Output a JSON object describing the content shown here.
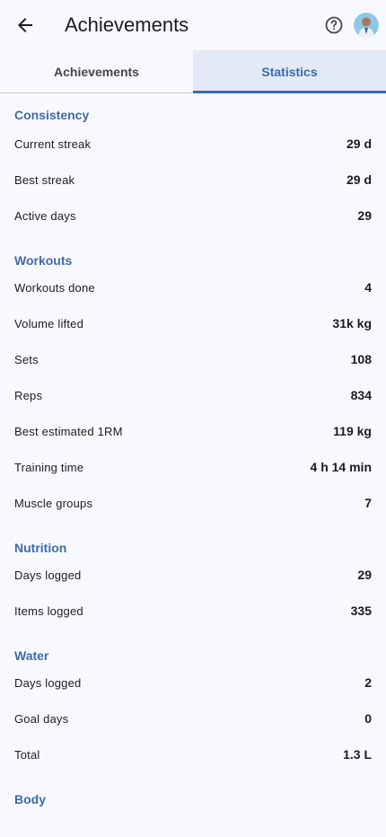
{
  "app_bar": {
    "title": "Achievements",
    "back_icon": "arrow-back-icon",
    "help_icon": "help-circle-icon",
    "avatar_icon": "user-avatar"
  },
  "tabs": [
    {
      "label": "Achievements",
      "active": false
    },
    {
      "label": "Statistics",
      "active": true
    }
  ],
  "sections": [
    {
      "title": "Consistency",
      "rows": [
        {
          "label": "Current streak",
          "value": "29 d"
        },
        {
          "label": "Best streak",
          "value": "29 d"
        },
        {
          "label": "Active days",
          "value": "29"
        }
      ]
    },
    {
      "title": "Workouts",
      "rows": [
        {
          "label": "Workouts done",
          "value": "4"
        },
        {
          "label": "Volume lifted",
          "value": "31k kg"
        },
        {
          "label": "Sets",
          "value": "108"
        },
        {
          "label": "Reps",
          "value": "834"
        },
        {
          "label": "Best estimated 1RM",
          "value": "119 kg"
        },
        {
          "label": "Training time",
          "value": "4 h 14 min"
        },
        {
          "label": "Muscle groups",
          "value": "7"
        }
      ]
    },
    {
      "title": "Nutrition",
      "rows": [
        {
          "label": "Days logged",
          "value": "29"
        },
        {
          "label": "Items logged",
          "value": "335"
        }
      ]
    },
    {
      "title": "Water",
      "rows": [
        {
          "label": "Days logged",
          "value": "2"
        },
        {
          "label": "Goal days",
          "value": "0"
        },
        {
          "label": "Total",
          "value": "1.3 L"
        }
      ]
    },
    {
      "title": "Body",
      "rows": []
    }
  ],
  "colors": {
    "accent": "#3e6aa6",
    "background": "#f8f9ff",
    "active_tab_bg": "#e3e9f6"
  }
}
